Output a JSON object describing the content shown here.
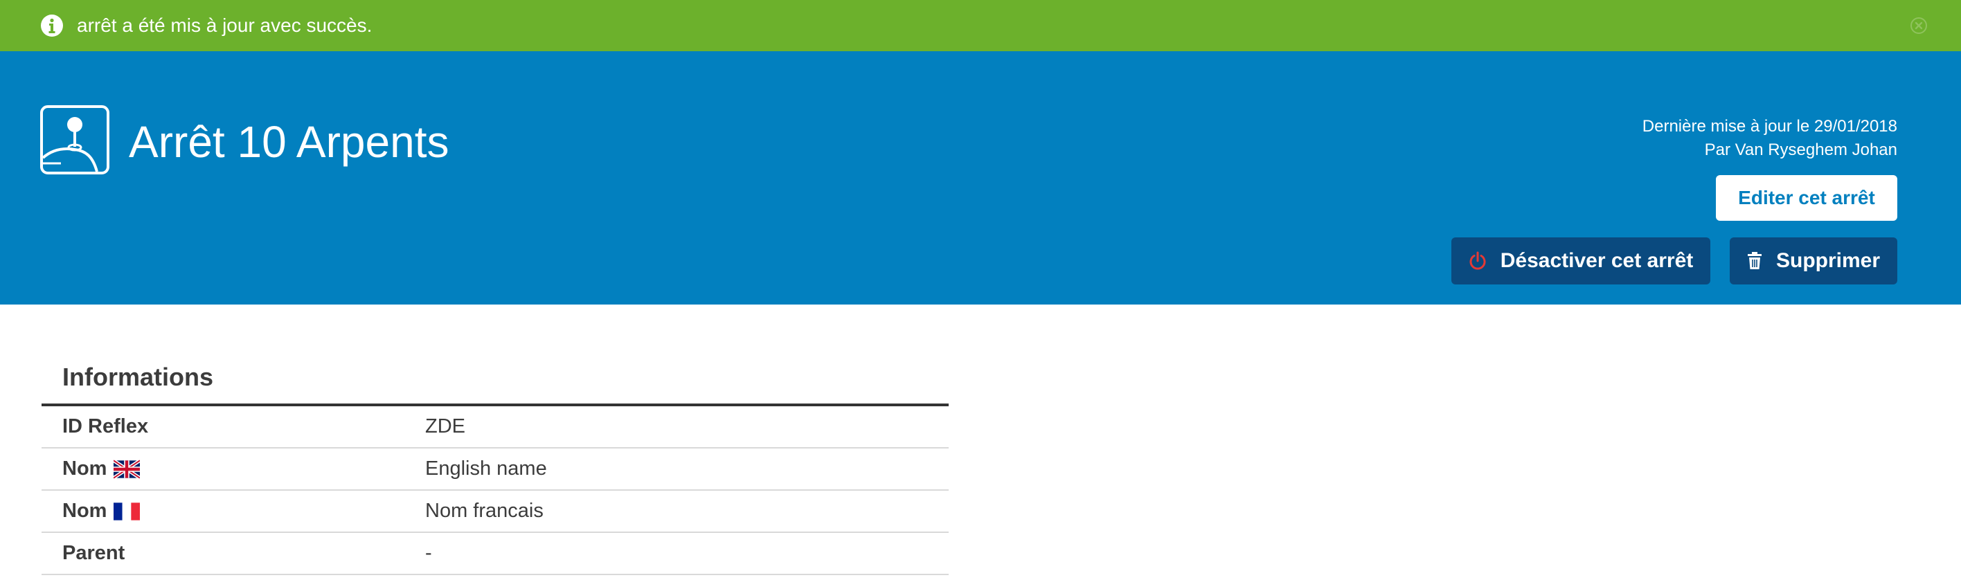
{
  "flash": {
    "message": "arrêt a été mis à jour avec succès.",
    "icon": "info-circle-icon",
    "close_icon": "close-circle-icon",
    "color": "#6cb12c"
  },
  "header": {
    "title": "Arrêt 10 Arpents",
    "icon": "stop-icon",
    "background": "#0280bf",
    "last_update": "Dernière mise à jour le 29/01/2018",
    "updated_by": "Par Van Ryseghem Johan",
    "edit_button": "Editer cet arrêt",
    "deactivate_button": "Désactiver cet arrêt",
    "deactivate_icon": "power-icon",
    "delete_button": "Supprimer",
    "delete_icon": "trash-icon"
  },
  "informations": {
    "title": "Informations",
    "rows": [
      {
        "label": "ID Reflex",
        "value": "ZDE"
      },
      {
        "label": "Nom",
        "flag": "uk-flag-icon",
        "value": "English name"
      },
      {
        "label": "Nom",
        "flag": "fr-flag-icon",
        "value": "Nom francais"
      },
      {
        "label": "Parent",
        "value": "-"
      }
    ]
  }
}
